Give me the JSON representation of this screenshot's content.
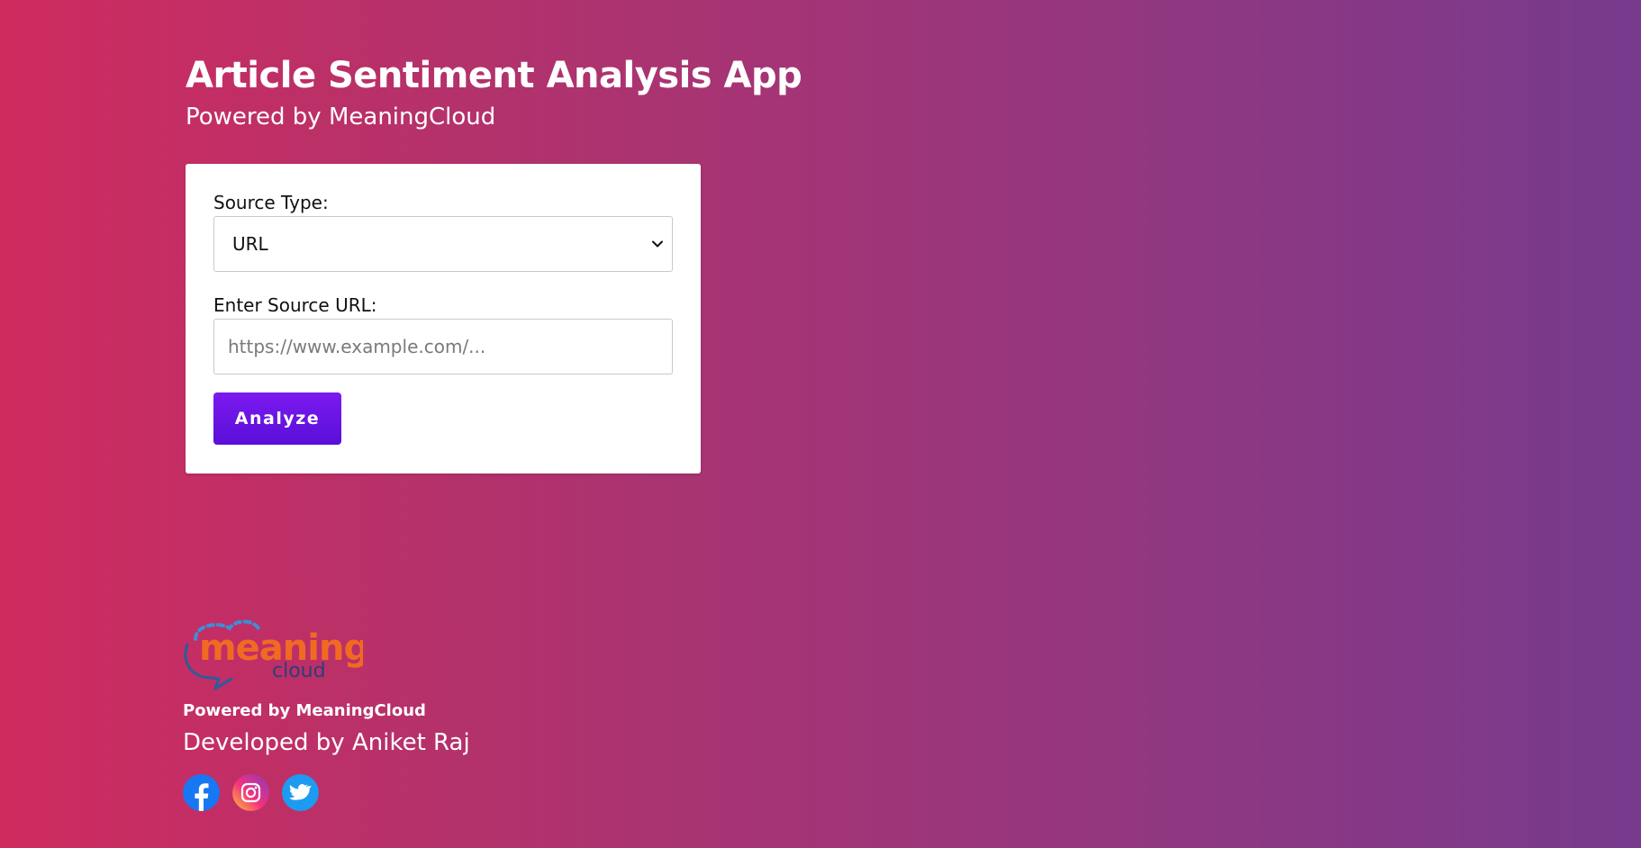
{
  "header": {
    "title": "Article Sentiment Analysis App",
    "subtitle": "Powered by MeaningCloud"
  },
  "form": {
    "source_type_label": "Source Type:",
    "source_type_selected": "URL",
    "source_url_label": "Enter Source URL:",
    "source_url_value": "",
    "source_url_placeholder": "https://www.example.com/...",
    "analyze_label": "Analyze"
  },
  "footer": {
    "logo_text": "meaning cloud",
    "powered_text": "Powered by MeaningCloud",
    "developed_text": "Developed by Aniket Raj",
    "social_icons": [
      "facebook-icon",
      "instagram-icon",
      "twitter-icon"
    ]
  },
  "colors": {
    "background_start": "#cf2b5f",
    "background_end": "#773a8d",
    "button": "#6a14e6",
    "logo_orange": "#f06a22",
    "logo_blue": "#3c8fd6"
  }
}
